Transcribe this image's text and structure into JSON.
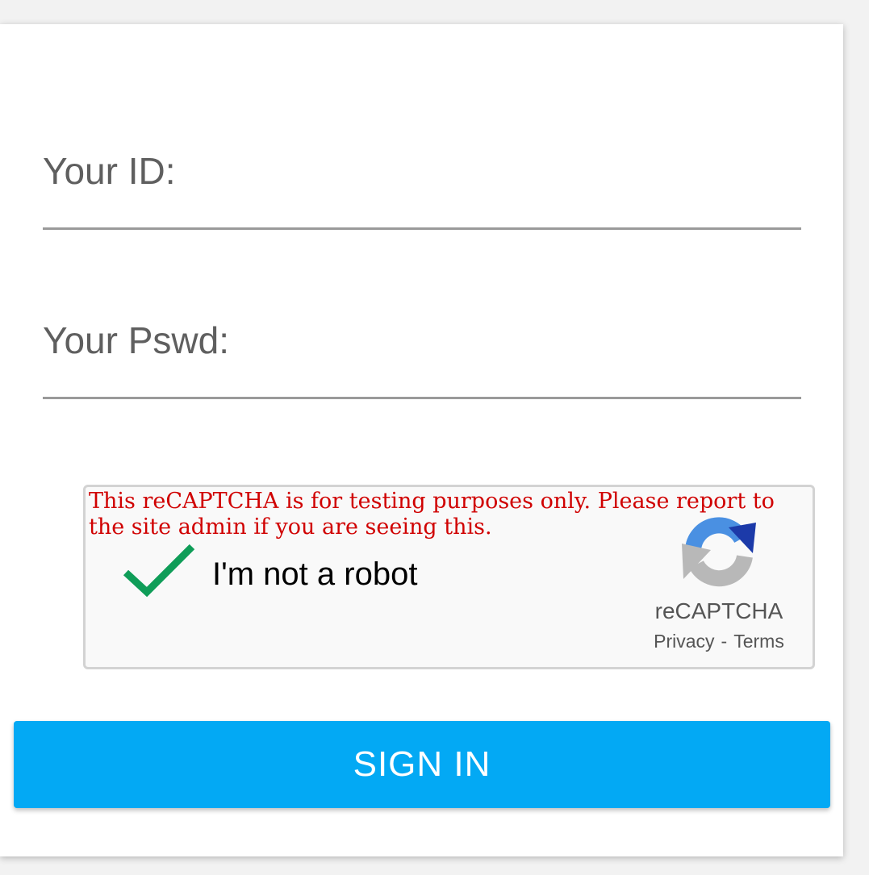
{
  "form": {
    "id_label": "Your ID:",
    "id_value": "",
    "pswd_label": "Your Pswd:",
    "pswd_value": ""
  },
  "recaptcha": {
    "warning": "This reCAPTCHA is for testing purposes only. Please report to the site admin if you are seeing this.",
    "checkbox_label": "I'm not a robot",
    "checked": true,
    "brand": "reCAPTCHA",
    "privacy_link": "Privacy",
    "separator": "-",
    "terms_link": "Terms",
    "check_color": "#0f9d58",
    "logo_blue": "#4a90e2",
    "logo_dark_blue": "#1c3aa9",
    "logo_gray": "#b8b8b8"
  },
  "actions": {
    "signin_label": "SIGN IN",
    "signin_color": "#03a9f4"
  }
}
